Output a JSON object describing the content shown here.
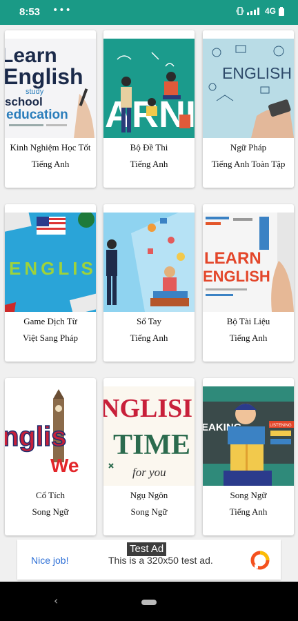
{
  "status": {
    "time": "8:53",
    "dots": "•••",
    "network": "4G"
  },
  "cards": [
    {
      "line1": "Kinh Nghiệm Học Tốt",
      "line2": "Tiếng Anh"
    },
    {
      "line1": "Bộ Đề Thi",
      "line2": "Tiếng Anh"
    },
    {
      "line1": "Ngữ Pháp",
      "line2": "Tiếng Anh Toàn Tập"
    },
    {
      "line1": "Game Dịch Từ",
      "line2": "Việt Sang Pháp"
    },
    {
      "line1": "Sổ Tay",
      "line2": "Tiếng Anh"
    },
    {
      "line1": "Bộ Tài Liệu",
      "line2": "Tiếng Anh"
    },
    {
      "line1": "Cổ Tích",
      "line2": "Song Ngữ"
    },
    {
      "line1": "Ngụ Ngôn",
      "line2": "Song Ngữ"
    },
    {
      "line1": "Song Ngữ",
      "line2": "Tiếng Anh"
    }
  ],
  "thumbs": {
    "t1": {
      "w1": "Learn",
      "w2": "English",
      "w3": "school",
      "w4": "education",
      "w5": "study"
    },
    "t2": {
      "w1": "ARNI"
    },
    "t3": {
      "w1": "ENGLISH"
    },
    "t4": {
      "w1": "ENGLISH"
    },
    "t6": {
      "w1": "LEARN",
      "w2": "ENGLISH"
    },
    "t7": {
      "w1": "nglis",
      "w2": "We"
    },
    "t8": {
      "w1": "NGLISI",
      "w2": "TIME",
      "w3": "for you"
    },
    "t9": {
      "w1": "EAKING",
      "w2": "LISTENING"
    }
  },
  "ad": {
    "badge": "Test Ad",
    "nice": "Nice job!",
    "text": "This is a 320x50 test ad."
  },
  "colors": {
    "status_bar": "#1a9a86",
    "ad_link": "#2d6fd6"
  }
}
